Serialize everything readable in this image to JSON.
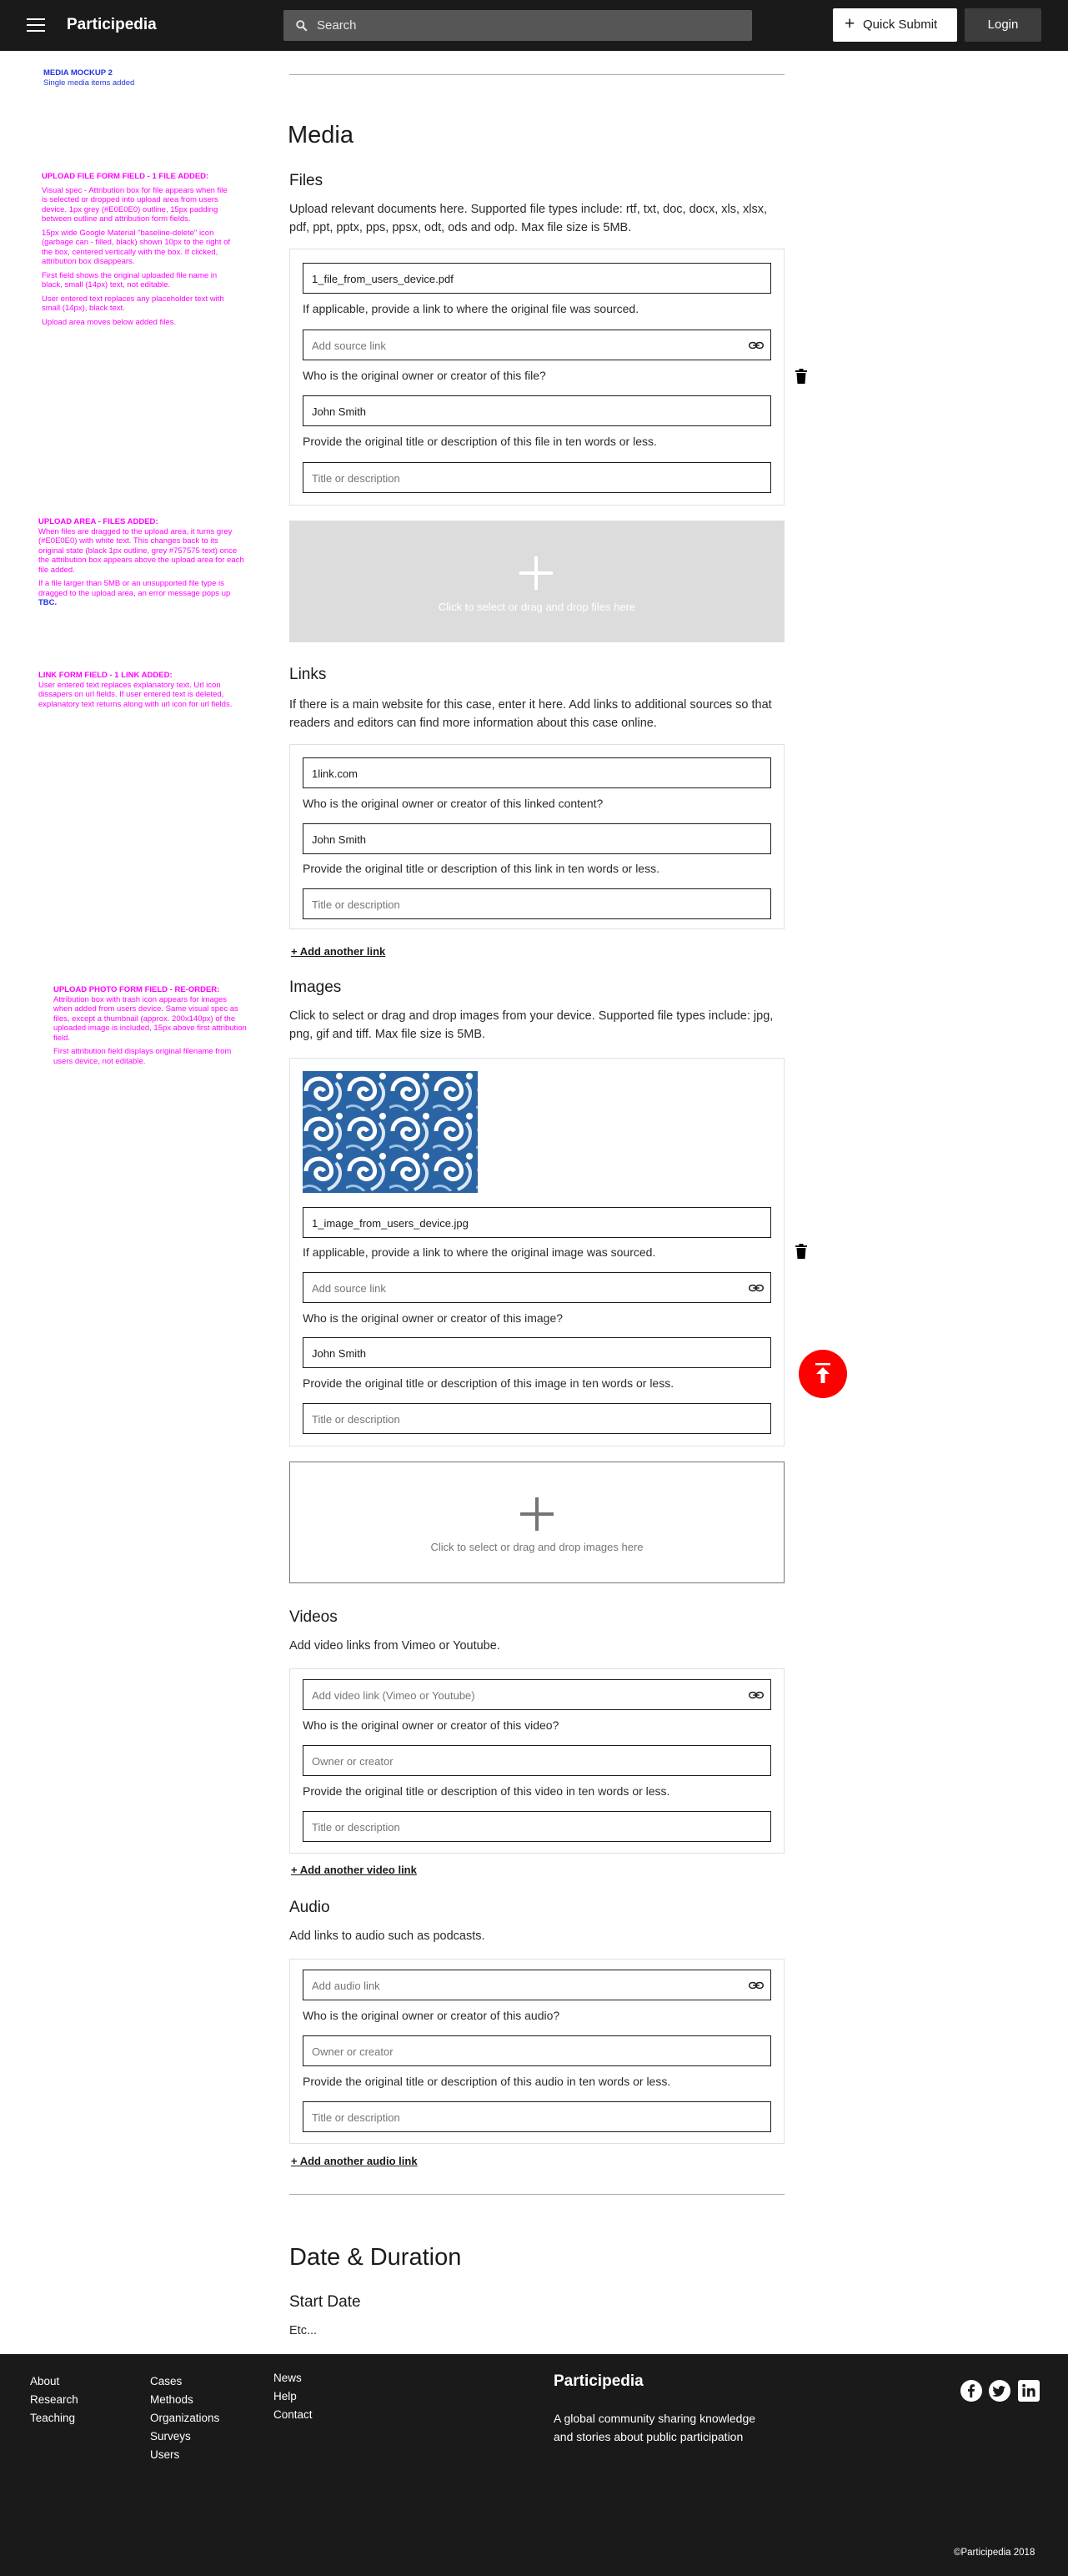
{
  "nav": {
    "brand": "Participedia",
    "search_placeholder": "Search",
    "quick_submit": "Quick Submit",
    "login": "Login"
  },
  "notes": {
    "mockup_title": "MEDIA MOCKUP 2",
    "mockup_subtitle": "Single media items added",
    "upload_file_title": "UPLOAD FILE FORM FIELD - 1 FILE ADDED:",
    "upload_file_p1": "Visual spec - Attribution box for file appears when file is selected or dropped into upload area from users device. 1px grey (#E0E0E0) outline, 15px padding between outline and attribution form fields.",
    "upload_file_p2": "15px wide Google Material \"baseline-delete\" icon (garbage can - filled, black) shown 10px to the right of the box, centered vertically with the box. If clicked, attribution box disappears.",
    "upload_file_p3": "First field shows the original uploaded file name in black, small (14px) text, not editable.",
    "upload_file_p4": "User entered text replaces any placeholder text with small (14px), black text.",
    "upload_file_p5": "Upload area moves below added files.",
    "upload_area_title": "UPLOAD AREA - FILES ADDED:",
    "upload_area_p1": "When files are dragged to the upload area, it turns grey (#E0E0E0) with white text. This changes back to its original state (black 1px outline, grey #757575 text) once the attribution box appears above the upload area for each file added.",
    "upload_area_p2": "If a file larger than 5MB or an unsupported file type is dragged to the upload area, an error message pops up",
    "upload_area_tbc": "TBC.",
    "link_title": "LINK FORM FIELD - 1 LINK ADDED:",
    "link_p1": "User entered text replaces explanatory text. Url icon dissapers on url fields. If user entered text is deleted, explanatory text returns along with url icon for url fields.",
    "photo_title": "UPLOAD PHOTO FORM FIELD - RE-ORDER:",
    "photo_p1": "Attribution box with trash icon appears for images when added from users device. Same visual spec as files, except a thumbnail (approx. 200x140px) of the uploaded image is included, 15px above first attribution field.",
    "photo_p2": "First attribution field displays original filename from users device, not editable."
  },
  "media": {
    "title": "Media"
  },
  "files": {
    "title": "Files",
    "desc": "Upload relevant documents here. Supported file types include: rtf, txt, doc, docx, xls, xlsx, pdf, ppt, pptx, pps, ppsx, odt, ods and odp. Max file size is 5MB.",
    "filename": "1_file_from_users_device.pdf",
    "source_label": "If applicable, provide a link to where the original file was sourced.",
    "source_placeholder": "Add source link",
    "owner_label": "Who is the original owner or creator of this file?",
    "owner_value": "John Smith",
    "title_label": "Provide the original title or description of this file in ten words or less.",
    "title_placeholder": "Title or description",
    "upload_text": "Click to select or drag and drop files here"
  },
  "links": {
    "title": "Links",
    "desc": "If there is a main website for this case, enter it here. Add links to additional sources so that readers and editors can find more information about this case online.",
    "url_value": "1link.com",
    "owner_label": "Who is the original owner or creator of this linked content?",
    "owner_value": "John Smith",
    "title_label": "Provide the original title or description of this link in ten words or less.",
    "title_placeholder": "Title or description",
    "add_another": "+ Add another link"
  },
  "images": {
    "title": "Images",
    "desc": "Click to select or drag and drop images from your device. Supported file types include: jpg, png, gif and tiff. Max file size is 5MB.",
    "filename": "1_image_from_users_device.jpg",
    "source_label": "If applicable, provide a link to where the original image was sourced.",
    "source_placeholder": "Add source link",
    "owner_label": "Who is the original owner or creator of this image?",
    "owner_value": "John Smith",
    "title_label": "Provide the original title or description of this image in ten words or less.",
    "title_placeholder": "Title or description",
    "upload_text": "Click to select or drag and drop images here"
  },
  "videos": {
    "title": "Videos",
    "desc": "Add video links from Vimeo or Youtube.",
    "url_placeholder": "Add video link (Vimeo or Youtube)",
    "owner_label": "Who is the original owner or creator of this video?",
    "owner_placeholder": "Owner or creator",
    "title_label": "Provide the original title or description of this video in ten words or less.",
    "title_placeholder": "Title or description",
    "add_another": "+ Add another video link"
  },
  "audio": {
    "title": "Audio",
    "desc": "Add links to audio such as podcasts.",
    "url_placeholder": "Add audio link",
    "owner_label": "Who is the original owner or creator of this audio?",
    "owner_placeholder": "Owner or creator",
    "title_label": "Provide the original title or description of this audio in ten words or less.",
    "title_placeholder": "Title or description",
    "add_another": "+ Add another audio link"
  },
  "date": {
    "title": "Date & Duration",
    "start": "Start Date",
    "etc": "Etc..."
  },
  "footer": {
    "col1": [
      "About",
      "Research",
      "Teaching"
    ],
    "col2": [
      "Cases",
      "Methods",
      "Organizations",
      "Surveys",
      "Users"
    ],
    "col3": [
      "News",
      "Help",
      "Contact"
    ],
    "brand": "Participedia",
    "tagline_1": "A global community sharing knowledge",
    "tagline_2": "and stories about public participation",
    "copyright": "©Participedia 2018"
  },
  "colors": {
    "accent_magenta": "#ff00ff",
    "fab_red": "#ff0000",
    "nav_dark": "#1a1a1a"
  }
}
